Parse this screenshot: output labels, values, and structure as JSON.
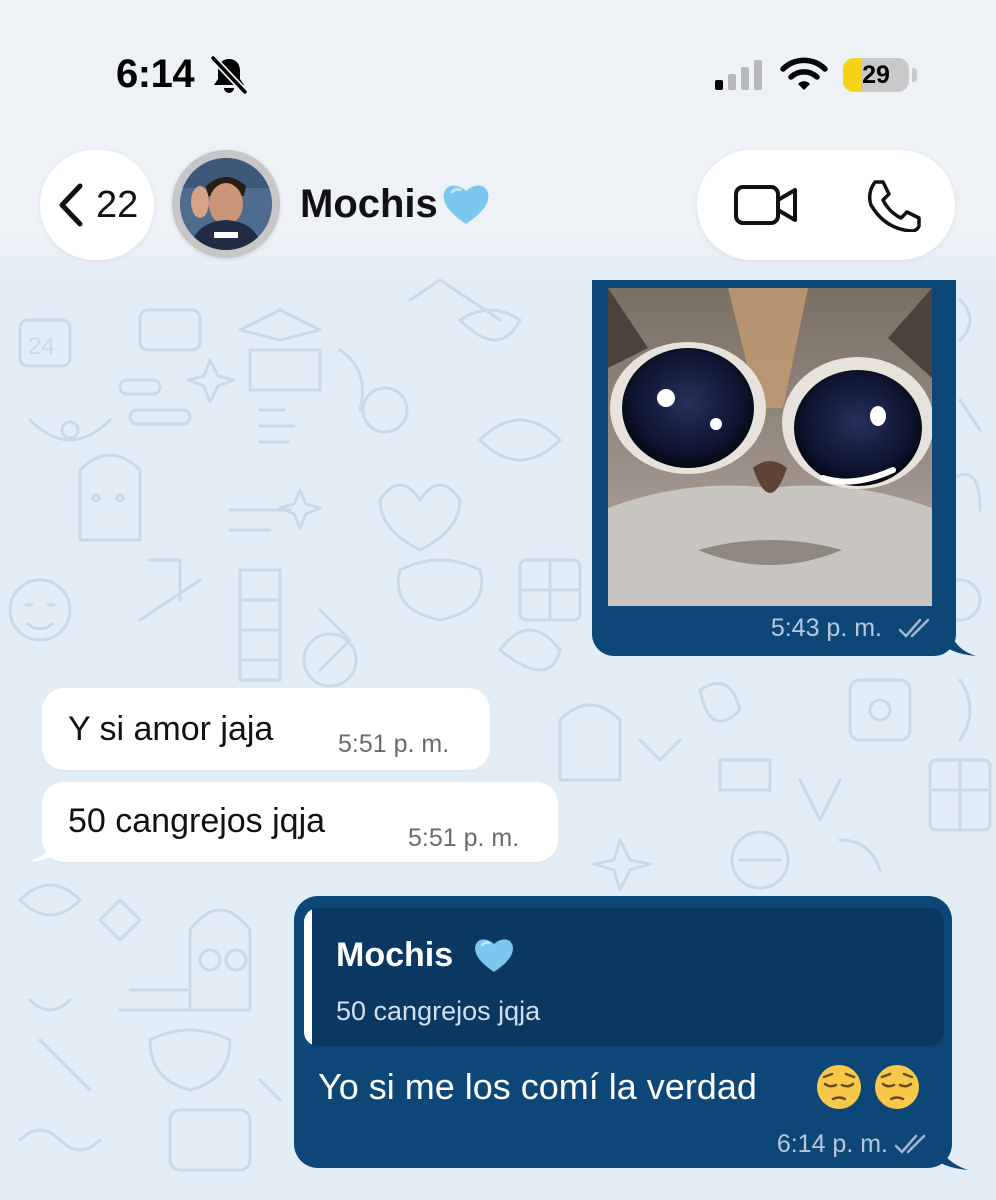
{
  "status_bar": {
    "time": "6:14",
    "battery": "29",
    "battery_level": 0.29,
    "icons": [
      "bell-slash-icon",
      "cellular-signal-icon",
      "wifi-icon",
      "battery-icon"
    ]
  },
  "header": {
    "back_count": "22",
    "contact_name": "Mochis",
    "name_emoji": "light-blue-heart",
    "icons": [
      "chevron-left-icon",
      "video-call-icon",
      "phone-call-icon"
    ]
  },
  "messages": {
    "image_message": {
      "time": "5:43 p. m."
    },
    "incoming": [
      {
        "text": "Y si amor jaja",
        "time": "5:51 p. m."
      },
      {
        "text": "50 cangrejos jqja",
        "time": "5:51 p. m."
      }
    ],
    "reply": {
      "quoted_author": "Mochis",
      "quoted_text": "50 cangrejos jqja",
      "text": "Yo si me los comí la verdad",
      "emojis": [
        "pensive-face",
        "pensive-face"
      ],
      "time": "6:14 p. m."
    }
  },
  "colors": {
    "outgoing_bubble": "#0d4778",
    "incoming_bubble": "#ffffff",
    "wallpaper": "#e3edf6",
    "battery_fill": "#f6d317"
  }
}
